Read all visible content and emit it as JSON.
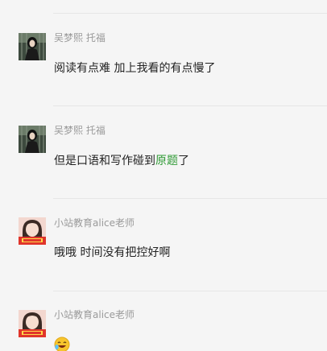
{
  "messages": [
    {
      "sender": "吴梦熙 托福",
      "avatar_icon": "woman-dark-photo-avatar",
      "text": "阅读有点难 加上我看的有点慢了"
    },
    {
      "sender": "吴梦熙 托福",
      "avatar_icon": "woman-dark-photo-avatar",
      "text_before": "但是口语和写作碰到",
      "text_link": "原题",
      "text_after": "了"
    },
    {
      "sender": "小站教育alice老师",
      "avatar_icon": "teacher-red-photo-avatar",
      "text": "哦哦  时间没有把控好啊"
    },
    {
      "sender": "小站教育alice老师",
      "avatar_icon": "teacher-red-photo-avatar",
      "emoji": "smiley-emoji"
    }
  ],
  "colors": {
    "background": "#f5f5f5",
    "sender_name": "#9a9a9a",
    "message_text": "#222222",
    "link_text": "#2f9a35",
    "divider": "#e6e6e6"
  }
}
